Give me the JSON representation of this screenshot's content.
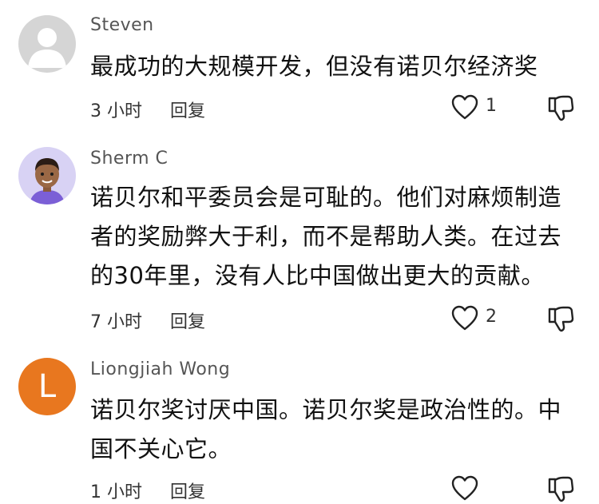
{
  "comments": [
    {
      "username": "Steven",
      "avatar": {
        "type": "default-silhouette",
        "color": "#d5d5d5"
      },
      "lines": [
        "最成功的大规模开发，但没有诺贝尔经济奖"
      ],
      "time": "3 小时",
      "reply_label": "回复",
      "like_count": "1"
    },
    {
      "username": "Sherm C",
      "avatar": {
        "type": "cartoon-boy",
        "color": "#d8d2f4"
      },
      "lines": [
        "诺贝尔和平委员会是可耻的。他们对麻烦制造",
        "者的奖励弊大于利，而不是帮助人类。在过去",
        "的30年里，没有人比中国做出更大的贡献。"
      ],
      "time": "7 小时",
      "reply_label": "回复",
      "like_count": "2"
    },
    {
      "username": "Liongjiah Wong",
      "avatar": {
        "type": "letter",
        "letter": "L",
        "color": "#e8771f"
      },
      "lines": [
        "诺贝尔奖讨厌中国。诺贝尔奖是政治性的。中",
        "国不关心它。"
      ],
      "time": "1 小时",
      "reply_label": "回复",
      "like_count": ""
    }
  ],
  "icons": {
    "like": "heart-outline-icon",
    "dislike": "thumbs-down-outline-icon"
  }
}
